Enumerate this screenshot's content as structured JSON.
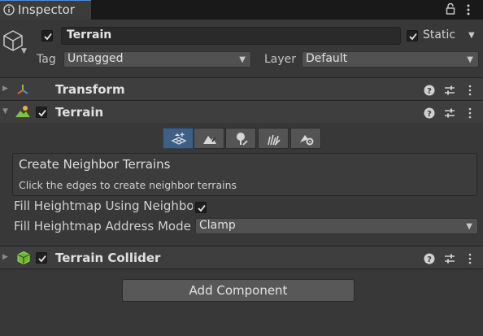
{
  "window": {
    "tab_label": "Inspector",
    "tab_icon": "info-icon",
    "lock_icon": "lock-icon",
    "menu_icon": "kebab-menu-icon"
  },
  "header": {
    "object_icon": "cube-icon",
    "active": true,
    "name": "Terrain",
    "static_checked": true,
    "static_label": "Static",
    "tag_label": "Tag",
    "tag_value": "Untagged",
    "layer_label": "Layer",
    "layer_value": "Default"
  },
  "components": {
    "transform": {
      "title": "Transform",
      "expanded": false,
      "icon": "transform-axes-icon"
    },
    "terrain": {
      "title": "Terrain",
      "expanded": true,
      "enabled": true,
      "icon": "terrain-icon"
    },
    "terrain_collider": {
      "title": "Terrain Collider",
      "expanded": false,
      "enabled": true,
      "icon": "collider-cube-icon"
    }
  },
  "terrain_tools": {
    "selected_index": 0,
    "tools": [
      {
        "icon": "create-neighbor-terrains-icon"
      },
      {
        "icon": "paint-terrain-icon"
      },
      {
        "icon": "paint-trees-icon"
      },
      {
        "icon": "paint-details-icon"
      },
      {
        "icon": "terrain-settings-icon"
      }
    ]
  },
  "neighbor_box": {
    "title": "Create Neighbor Terrains",
    "description": "Click the edges to create neighbor terrains"
  },
  "fields": {
    "fill_heightmap_label": "Fill Heightmap Using Neighbo",
    "fill_heightmap_checked": true,
    "address_mode_label": "Fill Heightmap Address Mode",
    "address_mode_value": "Clamp"
  },
  "add_component_label": "Add Component",
  "colors": {
    "accent": "#4d8ad8",
    "selected_tool": "#3f5f85",
    "panel_bg": "#383838",
    "header_bg": "#3e3e3e"
  }
}
